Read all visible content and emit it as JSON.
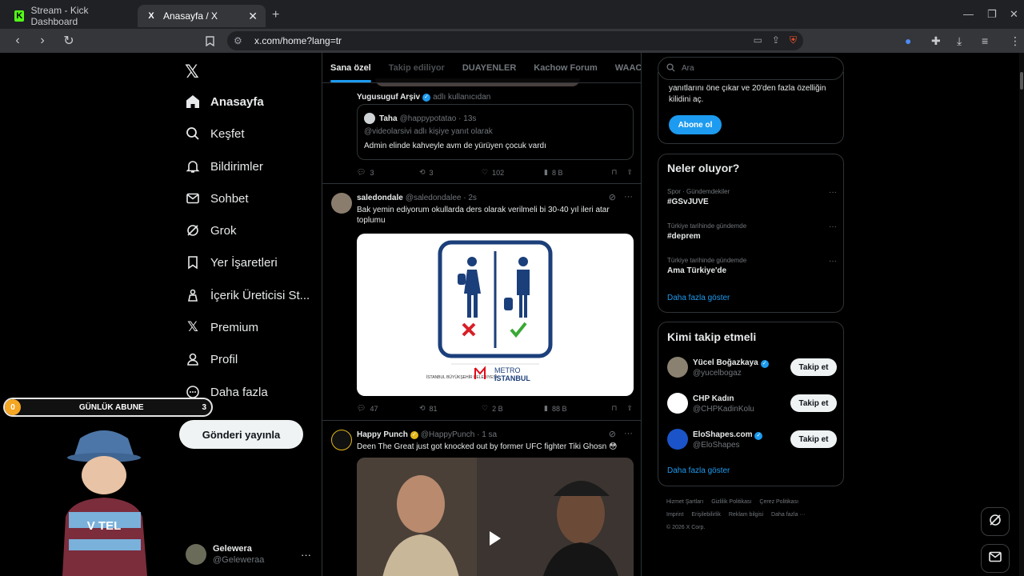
{
  "browser": {
    "tabs": [
      {
        "title": "Stream - Kick Dashboard",
        "favicon": "K"
      },
      {
        "title": "Anasayfa / X",
        "favicon": "X"
      }
    ],
    "url": "x.com/home?lang=tr"
  },
  "nav": {
    "items": [
      {
        "label": "Anasayfa",
        "icon": "home-icon"
      },
      {
        "label": "Keşfet",
        "icon": "search-icon"
      },
      {
        "label": "Bildirimler",
        "icon": "bell-icon"
      },
      {
        "label": "Sohbet",
        "icon": "mail-icon"
      },
      {
        "label": "Grok",
        "icon": "grok-icon"
      },
      {
        "label": "Yer İşaretleri",
        "icon": "bookmark-icon"
      },
      {
        "label": "İçerik Üreticisi St...",
        "icon": "creator-icon"
      },
      {
        "label": "Premium",
        "icon": "x-icon"
      },
      {
        "label": "Profil",
        "icon": "person-icon"
      },
      {
        "label": "Daha fazla",
        "icon": "more-circle-icon"
      }
    ],
    "post_button": "Gönderi yayınla",
    "account": {
      "name": "Gelewera",
      "handle": "@Geleweraa"
    }
  },
  "overlay": {
    "label": "GÜNLÜK ABUNE",
    "start": "0",
    "count": "3"
  },
  "timeline": {
    "tabs": [
      "Sana özel",
      "Takip ediliyor",
      "DUAYENLER",
      "Kachow Forum",
      "WAAC Club"
    ],
    "post1": {
      "header_name": "Yugusuguf Arşiv",
      "header_note": "adlı kullanıcıdan",
      "quote": {
        "name": "Taha",
        "handle": "@happypotatao · 13s",
        "reply_to": "@videolarsivi adlı kişiye yanıt olarak",
        "text": "Admin elinde kahveyle avm de yürüyen çocuk vardı"
      },
      "stats": {
        "replies": "3",
        "reposts": "3",
        "likes": "102",
        "views": "8 B"
      }
    },
    "post2": {
      "name": "saledondale",
      "handle": "@saledondalee · 2s",
      "text": "Bak yemin ediyorum okullarda ders olarak verilmeli bi 30-40 yıl ileri atar toplumu",
      "image_brand_small": "İSTANBUL BÜYÜKŞEHİR BELEDİYESİ",
      "image_brand_1": "METRO",
      "image_brand_2": "İSTANBUL",
      "stats": {
        "replies": "47",
        "reposts": "81",
        "likes": "2 B",
        "views": "88 B"
      }
    },
    "post3": {
      "name": "Happy Punch",
      "handle": "@HappyPunch · 1 sa",
      "text": "Deen The Great just got knocked out by former UFC fighter Tiki Ghosn 😳"
    }
  },
  "sidebar": {
    "search_placeholder": "Ara",
    "premium_text": "yanıtlarını öne çıkar ve 20'den fazla özelliğin kilidini aç.",
    "premium_button": "Abone ol",
    "trends_title": "Neler oluyor?",
    "trends": [
      {
        "category": "Spor · Gündemdekiler",
        "name": "#GSvJUVE"
      },
      {
        "category": "Türkiye tarihinde gündemde",
        "name": "#deprem"
      },
      {
        "category": "Türkiye tarihinde gündemde",
        "name": "Ama Türkiye'de"
      }
    ],
    "show_more": "Daha fazla göster",
    "who_title": "Kimi takip etmeli",
    "who": [
      {
        "name": "Yücel Boğazkaya",
        "handle": "@yucelbogaz",
        "verified": true
      },
      {
        "name": "CHP Kadın",
        "handle": "@CHPKadinKolu",
        "verified": false
      },
      {
        "name": "EloShapes.com",
        "handle": "@EloShapes",
        "verified": true
      }
    ],
    "follow_label": "Takip et",
    "footer": [
      "Hizmet Şartları",
      "Gizlilik Politikası",
      "Çerez Politikası",
      "Imprint",
      "Erişilebilirlik",
      "Reklam bilgisi",
      "Daha fazla ···",
      "© 2026 X Corp."
    ]
  }
}
